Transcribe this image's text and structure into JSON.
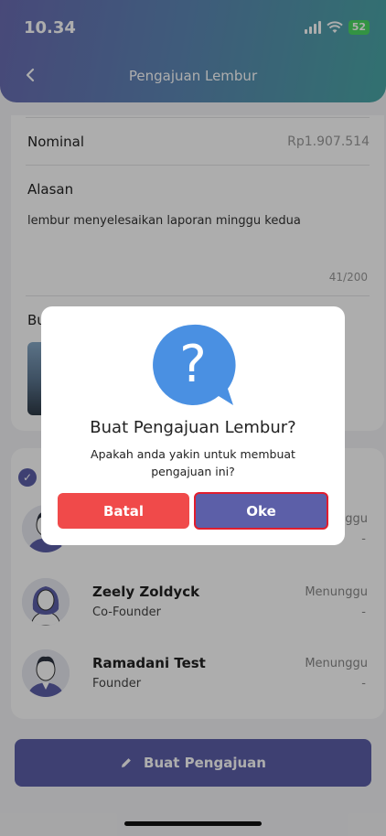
{
  "status_bar": {
    "time": "10.34",
    "battery": "52"
  },
  "header": {
    "title": "Pengajuan Lembur"
  },
  "form": {
    "nominal_label": "Nominal",
    "nominal_value": "Rp1.907.514",
    "alasan_label": "Alasan",
    "alasan_text": "lembur menyelesaikan laporan minggu kedua",
    "counter": "41/200",
    "bukti_label": "Bu"
  },
  "approvers": [
    {
      "name": "",
      "role": "",
      "status": "nggu",
      "dash": "-"
    },
    {
      "name": "Zeely Zoldyck",
      "role": "Co-Founder",
      "status": "Menunggu",
      "dash": "-"
    },
    {
      "name": "Ramadani Test",
      "role": "Founder",
      "status": "Menunggu",
      "dash": "-"
    }
  ],
  "submit_button": {
    "label": "Buat Pengajuan"
  },
  "dialog": {
    "title": "Buat Pengajuan Lembur?",
    "text": "Apakah anda yakin untuk membuat pengajuan ini?",
    "cancel_label": "Batal",
    "ok_label": "Oke"
  },
  "colors": {
    "primary": "#5c5fa8",
    "danger": "#f04a4a",
    "question_icon": "#4a90e2"
  },
  "icons": {
    "back": "chevron-left-icon",
    "edit": "pencil-icon",
    "question": "question-bubble-icon",
    "check": "check-circle-icon"
  }
}
